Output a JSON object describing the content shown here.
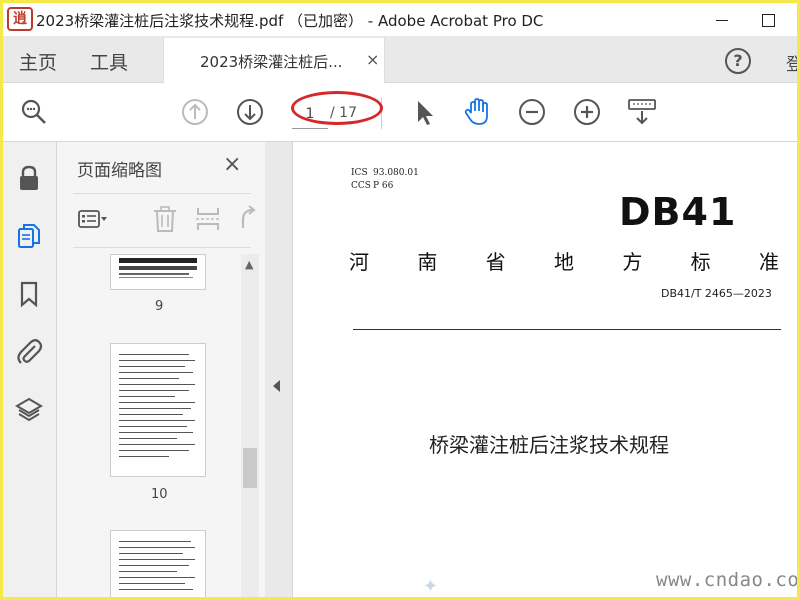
{
  "window": {
    "logo_text": "逍",
    "title": "2023桥梁灌注桩后注浆技术规程.pdf （已加密） - Adobe Acrobat Pro DC"
  },
  "tabs": {
    "home": "主页",
    "tools": "工具",
    "document": "2023桥梁灌注桩后...",
    "document_close": "×",
    "help": "?",
    "login": "登"
  },
  "toolbar": {
    "icons": [
      "search-zoom-icon",
      "page-up-icon",
      "page-down-icon",
      "select-pointer-icon",
      "hand-tool-icon",
      "zoom-out-icon",
      "zoom-in-icon",
      "keyboard-scroll-icon"
    ],
    "current_page": "1",
    "total_pages": "/ 17"
  },
  "rail": {
    "icons": [
      "lock-icon",
      "page-thumbnails-icon",
      "bookmark-icon",
      "attachment-icon",
      "layers-icon"
    ]
  },
  "thumbnail_panel": {
    "title": "页面缩略图",
    "close": "×",
    "tools": [
      "page-options-icon",
      "delete-icon",
      "extract-icon",
      "rotate-icon"
    ],
    "pages": [
      {
        "number": "9"
      },
      {
        "number": "10"
      },
      {
        "number": ""
      }
    ]
  },
  "document": {
    "ics_label": "ICS",
    "ics_value": "93.080.01",
    "ccs_label": "CCS",
    "ccs_value": "P 66",
    "standard_prefix": "DB41",
    "standard_name_chars": [
      "河",
      "南",
      "省",
      "地",
      "方",
      "标",
      "准"
    ],
    "standard_code": "DB41/T 2465—2023",
    "title": "桥梁灌注桩后注浆技术规程"
  },
  "watermark": {
    "site": "www.cndao.com"
  },
  "colors": {
    "frame_border": "#f5e94a",
    "annotation_red": "#d62828",
    "hand_tool_blue": "#1473e6",
    "active_rail_blue": "#1473e6"
  }
}
